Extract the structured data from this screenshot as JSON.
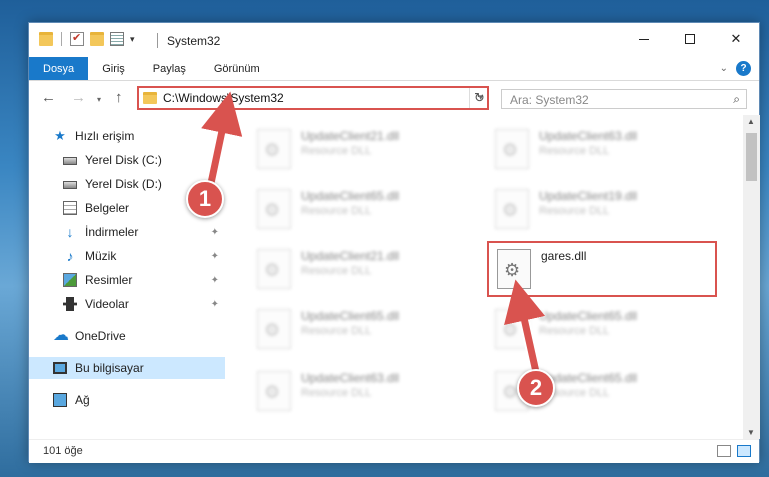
{
  "window": {
    "title": "System32",
    "icons": [
      "folder-icon",
      "checkmark-icon",
      "properties-icon"
    ],
    "controls": {
      "minimize": "–",
      "maximize": "□",
      "close": "✕"
    }
  },
  "ribbon": {
    "tabs": [
      {
        "label": "Dosya",
        "active": true
      },
      {
        "label": "Giriş",
        "active": false
      },
      {
        "label": "Paylaş",
        "active": false
      },
      {
        "label": "Görünüm",
        "active": false
      }
    ],
    "help": "?",
    "accent": "#1979ca"
  },
  "nav": {
    "back": "←",
    "forward": "→",
    "recent": "▾",
    "up": "↑",
    "address": "C:\\Windows\\System32",
    "refresh": "↻",
    "search_placeholder": "Ara: System32",
    "search_icon": "⚲"
  },
  "sidebar": {
    "items": [
      {
        "label": "Hızlı erişim",
        "icon": "star-icon",
        "pinned": false
      },
      {
        "label": "Yerel Disk (C:)",
        "icon": "disk-icon",
        "pinned": false
      },
      {
        "label": "Yerel Disk (D:)",
        "icon": "disk-icon",
        "pinned": false
      },
      {
        "label": "Belgeler",
        "icon": "document-icon",
        "pinned": false
      },
      {
        "label": "İndirmeler",
        "icon": "download-icon",
        "pinned": true
      },
      {
        "label": "Müzik",
        "icon": "music-icon",
        "pinned": true
      },
      {
        "label": "Resimler",
        "icon": "pictures-icon",
        "pinned": true
      },
      {
        "label": "Videolar",
        "icon": "videos-icon",
        "pinned": true
      },
      {
        "label": "OneDrive",
        "icon": "cloud-icon",
        "pinned": false
      },
      {
        "label": "Bu bilgisayar",
        "icon": "computer-icon",
        "pinned": false,
        "selected": true
      },
      {
        "label": "Ağ",
        "icon": "network-icon",
        "pinned": false
      }
    ],
    "pin_glyph": "📌"
  },
  "files": [
    {
      "name": "UpdateClient21.dll",
      "type": "Resource DLL",
      "blurred": true
    },
    {
      "name": "UpdateClient63.dll",
      "type": "Resource DLL",
      "blurred": true
    },
    {
      "name": "UpdateClient65.dll",
      "type": "Resource DLL",
      "blurred": true
    },
    {
      "name": "UpdateClient19.dll",
      "type": "Resource DLL",
      "blurred": true
    },
    {
      "name": "UpdateClient21.dll",
      "type": "Resource DLL",
      "blurred": true
    },
    {
      "name": "gares.dll",
      "type": "",
      "blurred": false,
      "highlighted": true
    },
    {
      "name": "UpdateClient65.dll",
      "type": "Resource DLL",
      "blurred": true
    },
    {
      "name": "UpdateClient65.dll",
      "type": "Resource DLL",
      "blurred": true
    },
    {
      "name": "UpdateClient63.dll",
      "type": "Resource DLL",
      "blurred": true
    },
    {
      "name": "UpdateClient65.dll",
      "type": "Resource DLL",
      "blurred": true
    }
  ],
  "status": {
    "count": "101 öğe"
  },
  "annotations": {
    "steps": [
      "1",
      "2"
    ],
    "color": "#d9534f"
  }
}
